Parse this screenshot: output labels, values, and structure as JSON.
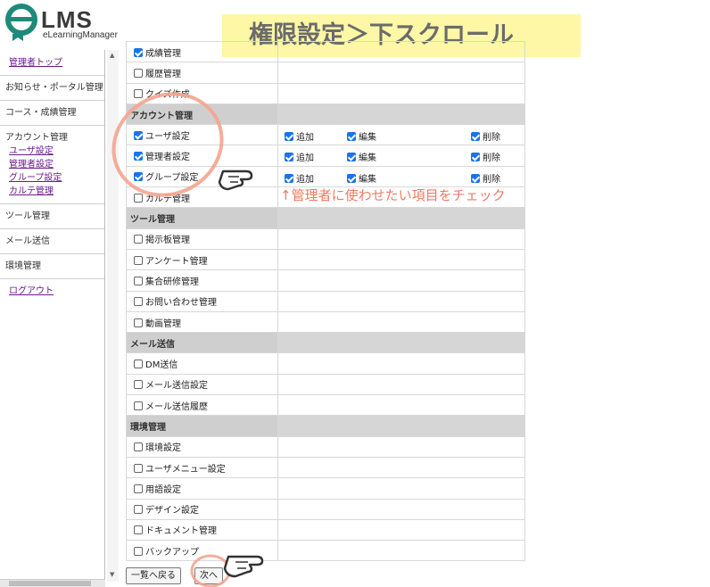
{
  "header": {
    "logo_text": "LMS",
    "logo_sub": "eLearningManager",
    "banner": "権限設定＞下スクロール"
  },
  "sidebar": {
    "admin_top": "管理者トップ",
    "notice_portal": "お知らせ・ポータル管理",
    "course_grades": "コース・成績管理",
    "account_head": "アカウント管理",
    "account_items": [
      "ユーザ設定",
      "管理者設定",
      "グループ設定",
      "カルテ管理"
    ],
    "tools": "ツール管理",
    "mail": "メール送信",
    "env": "環境管理",
    "logout": "ログアウト"
  },
  "table": {
    "rows": [
      {
        "type": "item",
        "label": "成績管理",
        "checked": true,
        "opts": []
      },
      {
        "type": "item",
        "label": "履歴管理",
        "checked": false,
        "opts": []
      },
      {
        "type": "item",
        "label": "クイズ作成",
        "checked": false,
        "opts": []
      },
      {
        "type": "section",
        "label": "アカウント管理"
      },
      {
        "type": "item",
        "label": "ユーザ設定",
        "checked": true,
        "opts": [
          "追加",
          "編集",
          "削除"
        ]
      },
      {
        "type": "item",
        "label": "管理者設定",
        "checked": true,
        "opts": [
          "追加",
          "編集",
          "削除"
        ]
      },
      {
        "type": "item",
        "label": "グループ設定",
        "checked": true,
        "opts": [
          "追加",
          "編集",
          "削除"
        ]
      },
      {
        "type": "item",
        "label": "カルテ管理",
        "checked": false,
        "opts": []
      },
      {
        "type": "section",
        "label": "ツール管理"
      },
      {
        "type": "item",
        "label": "掲示板管理",
        "checked": false,
        "opts": []
      },
      {
        "type": "item",
        "label": "アンケート管理",
        "checked": false,
        "opts": []
      },
      {
        "type": "item",
        "label": "集合研修管理",
        "checked": false,
        "opts": []
      },
      {
        "type": "item",
        "label": "お問い合わせ管理",
        "checked": false,
        "opts": []
      },
      {
        "type": "item",
        "label": "動画管理",
        "checked": false,
        "opts": []
      },
      {
        "type": "section",
        "label": "メール送信"
      },
      {
        "type": "item",
        "label": "DM送信",
        "checked": false,
        "opts": []
      },
      {
        "type": "item",
        "label": "メール送信設定",
        "checked": false,
        "opts": []
      },
      {
        "type": "item",
        "label": "メール送信履歴",
        "checked": false,
        "opts": []
      },
      {
        "type": "section",
        "label": "環境管理"
      },
      {
        "type": "item",
        "label": "環境設定",
        "checked": false,
        "opts": []
      },
      {
        "type": "item",
        "label": "ユーザメニュー設定",
        "checked": false,
        "opts": []
      },
      {
        "type": "item",
        "label": "用語設定",
        "checked": false,
        "opts": []
      },
      {
        "type": "item",
        "label": "デザイン設定",
        "checked": false,
        "opts": []
      },
      {
        "type": "item",
        "label": "ドキュメント管理",
        "checked": false,
        "opts": []
      },
      {
        "type": "item",
        "label": "バックアップ",
        "checked": false,
        "opts": []
      }
    ]
  },
  "buttons": {
    "back": "一覧へ戻る",
    "next": "次へ"
  },
  "annotation": "↑管理者に使わせたい項目をチェック",
  "colors": {
    "banner_bg": "#fdf7a6",
    "annotation": "#f07a63",
    "checkbox": "#1a73e8",
    "logo_teal": "#1e8a7a"
  },
  "icons": [
    "logo-graduate-icon",
    "pointing-hand-icon",
    "scroll-up-icon",
    "scroll-down-icon",
    "highlight-ellipse"
  ]
}
